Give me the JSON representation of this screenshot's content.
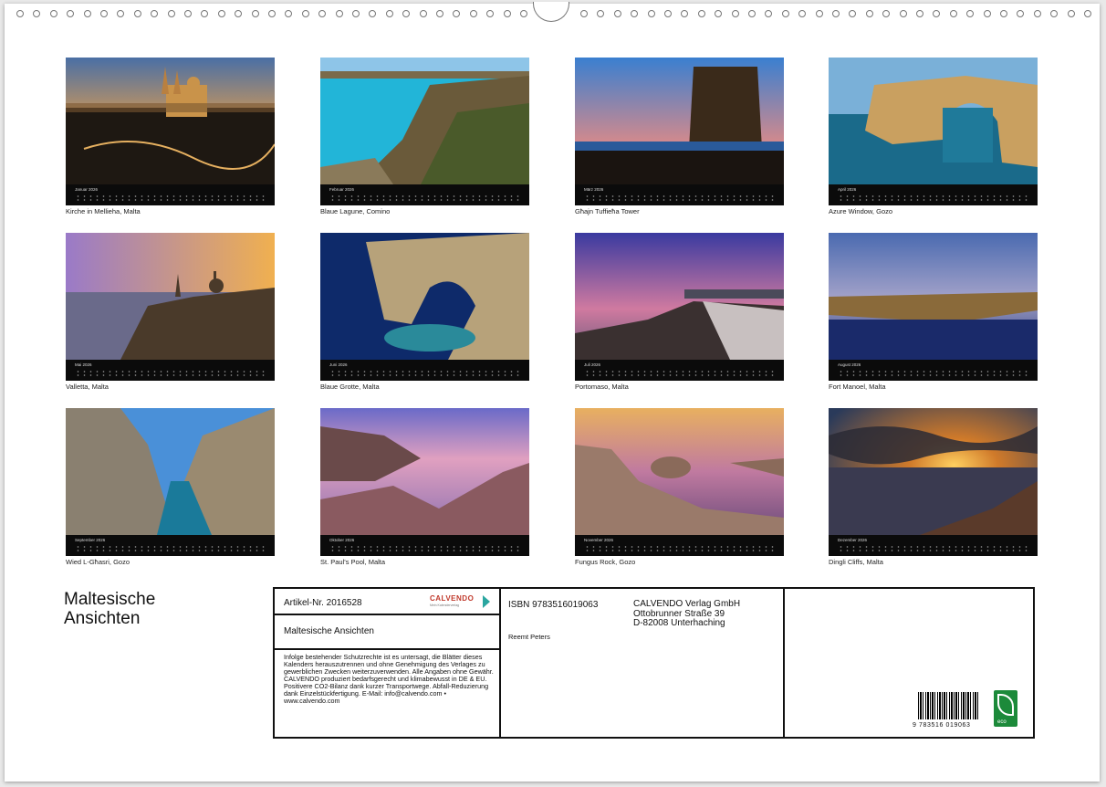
{
  "months": [
    {
      "label": "Januar 2026",
      "caption": "Kirche in Mellieha, Malta"
    },
    {
      "label": "Februar 2026",
      "caption": "Blaue Lagune, Comino"
    },
    {
      "label": "März 2026",
      "caption": "Għajn Tuffieħa Tower"
    },
    {
      "label": "April 2026",
      "caption": "Azure Window, Gozo"
    },
    {
      "label": "Mai 2026",
      "caption": "Valletta, Malta"
    },
    {
      "label": "Juni 2026",
      "caption": "Blaue Grotte, Malta"
    },
    {
      "label": "Juli 2026",
      "caption": "Portomaso, Malta"
    },
    {
      "label": "August 2026",
      "caption": "Fort Manoel, Malta"
    },
    {
      "label": "September 2026",
      "caption": "Wied L-Għasri, Gozo"
    },
    {
      "label": "Oktober 2026",
      "caption": "St. Paul's Pool, Malta"
    },
    {
      "label": "November 2026",
      "caption": "Fungus Rock, Gozo"
    },
    {
      "label": "Dezember 2026",
      "caption": "Dingli Cliffs, Malta"
    }
  ],
  "title": {
    "line1": "Maltesische",
    "line2": "Ansichten"
  },
  "info": {
    "article": "Artikel-Nr. 2016528",
    "logo_name": "CALVENDO",
    "logo_tagline": "Mein Kalenderverlag",
    "product_title": "Maltesische Ansichten",
    "legal": "Infolge bestehender Schutzrechte ist es untersagt, die Blätter dieses Kalenders herauszutrennen und ohne Genehmigung des Verlages zu gewerblichen Zwecken weiterzuverwenden. Alle Angaben ohne Gewähr. CALVENDO produziert bedarfsgerecht und klimabewusst in DE & EU. Positivere CO2-Bilanz dank kurzer Transportwege. Abfall-Reduzierung dank Einzelstückfertigung. E-Mail: info@calvendo.com • www.calvendo.com",
    "isbn": "ISBN 9783516019063",
    "author": "Reemt Peters",
    "publisher_line1": "CALVENDO Verlag GmbH",
    "publisher_line2": "Ottobrunner Straße 39",
    "publisher_line3": "D-82008 Unterhaching",
    "barcode_number": "9 783516 019063",
    "eco_label": "eco"
  }
}
